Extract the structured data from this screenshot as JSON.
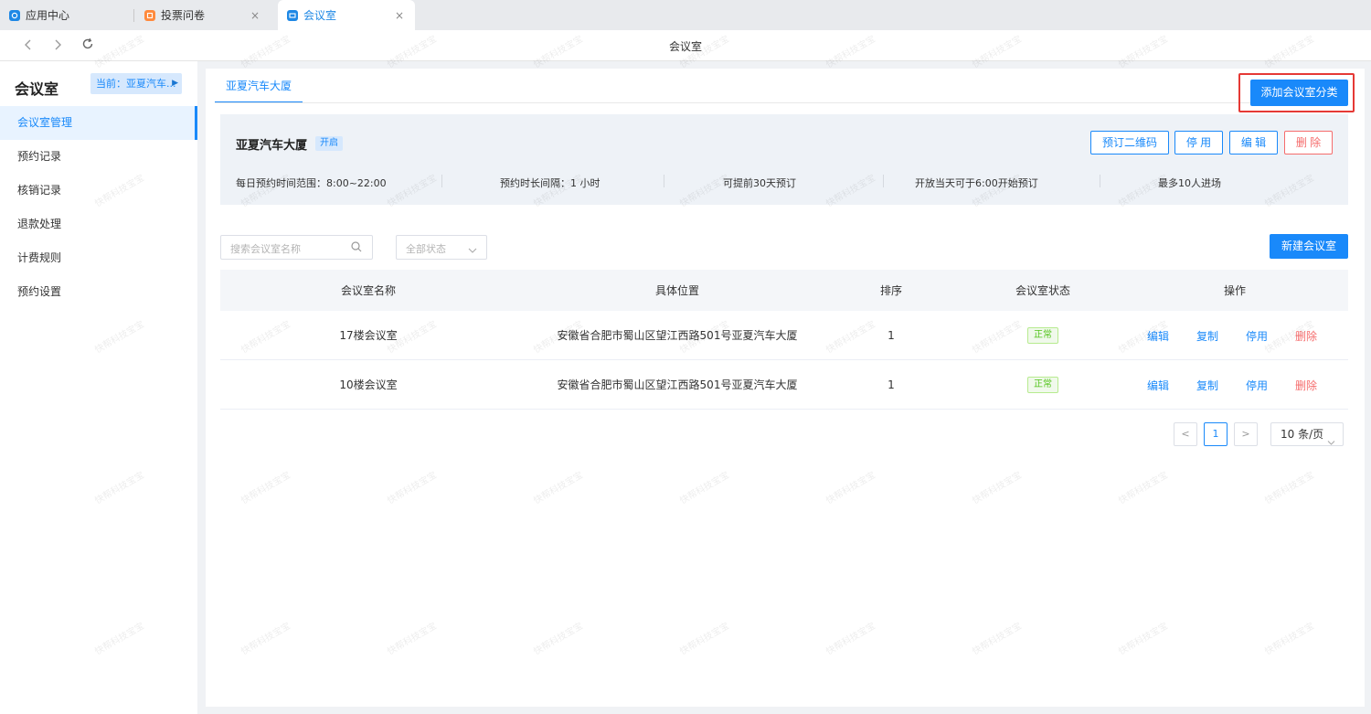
{
  "browser": {
    "tabs": [
      {
        "label": "应用中心",
        "icon": "app-center-icon"
      },
      {
        "label": "投票问卷",
        "icon": "vote-icon"
      },
      {
        "label": "会议室",
        "icon": "meeting-room-icon"
      }
    ],
    "close_glyph": "×",
    "page_title": "会议室"
  },
  "sidebar": {
    "title": "会议室",
    "current": "当前：亚夏汽车...",
    "items": [
      {
        "label": "会议室管理"
      },
      {
        "label": "预约记录"
      },
      {
        "label": "核销记录"
      },
      {
        "label": "退款处理"
      },
      {
        "label": "计费规则"
      },
      {
        "label": "预约设置"
      }
    ]
  },
  "main": {
    "category_tab": "亚夏汽车大厦",
    "add_category_label": "添加会议室分类",
    "info": {
      "title": "亚夏汽车大厦",
      "badge": "开启",
      "buttons": {
        "qrcode": "预订二维码",
        "disable": "停 用",
        "edit": "编 辑",
        "delete": "删 除"
      },
      "stats": [
        "每日预约时间范围：8:00~22:00",
        "预约时长间隔：1 小时",
        "可提前30天预订",
        "开放当天可于6:00开始预订",
        "最多10人进场"
      ]
    },
    "search_placeholder": "搜索会议室名称",
    "status_filter": "全部状态",
    "new_room_label": "新建会议室",
    "table": {
      "headers": {
        "name": "会议室名称",
        "location": "具体位置",
        "sort": "排序",
        "status": "会议室状态",
        "ops": "操作"
      },
      "rows": [
        {
          "name": "17楼会议室",
          "location": "安徽省合肥市蜀山区望江西路501号亚夏汽车大厦",
          "sort": "1",
          "status": "正常"
        },
        {
          "name": "10楼会议室",
          "location": "安徽省合肥市蜀山区望江西路501号亚夏汽车大厦",
          "sort": "1",
          "status": "正常"
        }
      ],
      "ops": {
        "edit": "编辑",
        "copy": "复制",
        "disable": "停用",
        "delete": "删除"
      }
    },
    "pagination": {
      "prev": "<",
      "page": "1",
      "next": ">",
      "page_size": "10 条/页"
    }
  },
  "watermark": "快帮科技宝宝",
  "colors": {
    "accent": "#1989fa",
    "danger": "#f56c6c",
    "success": "#52c41a",
    "highlight_border": "#e53935"
  }
}
